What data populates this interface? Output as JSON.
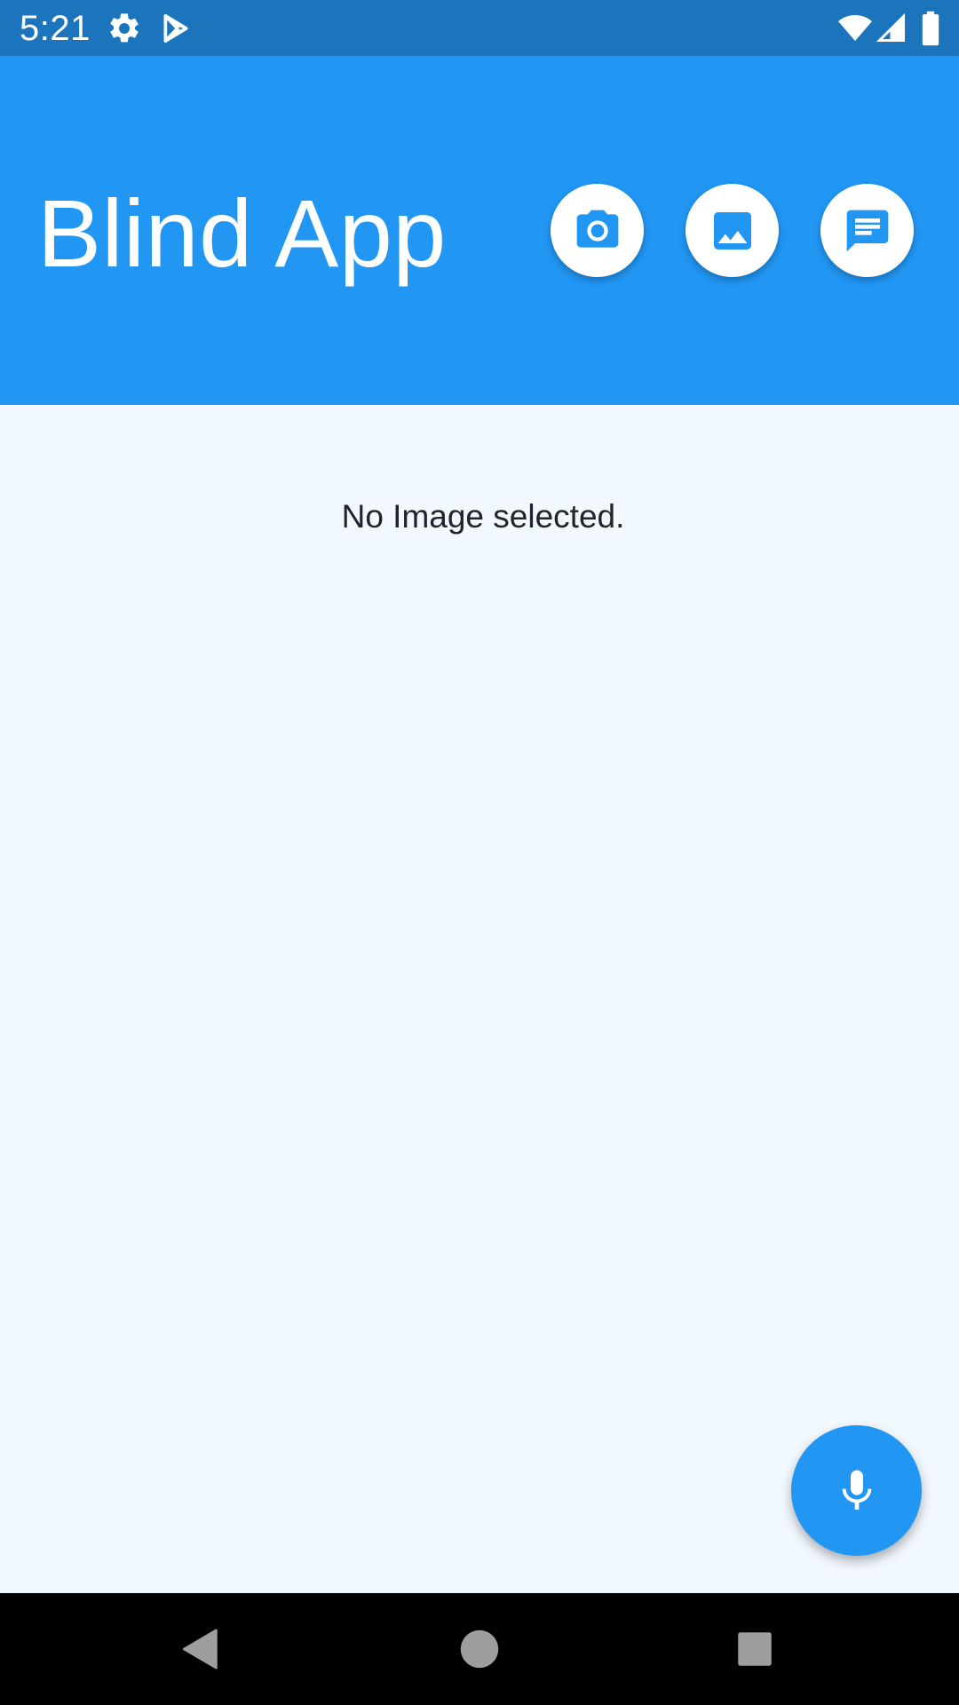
{
  "status_bar": {
    "time": "5:21",
    "icons": [
      "settings-icon",
      "play-store-icon",
      "wifi-icon",
      "cell-signal-icon",
      "battery-icon"
    ]
  },
  "header": {
    "title": "Blind App",
    "background_color": "#2196F3",
    "actions": [
      {
        "name": "camera-button",
        "icon": "camera-icon"
      },
      {
        "name": "gallery-button",
        "icon": "image-icon"
      },
      {
        "name": "message-button",
        "icon": "message-icon"
      }
    ]
  },
  "main": {
    "empty_message": "No Image selected."
  },
  "fab": {
    "icon": "microphone-icon",
    "color": "#2196F3"
  },
  "nav_bar": {
    "buttons": [
      "back-icon",
      "home-icon",
      "recents-icon"
    ]
  }
}
